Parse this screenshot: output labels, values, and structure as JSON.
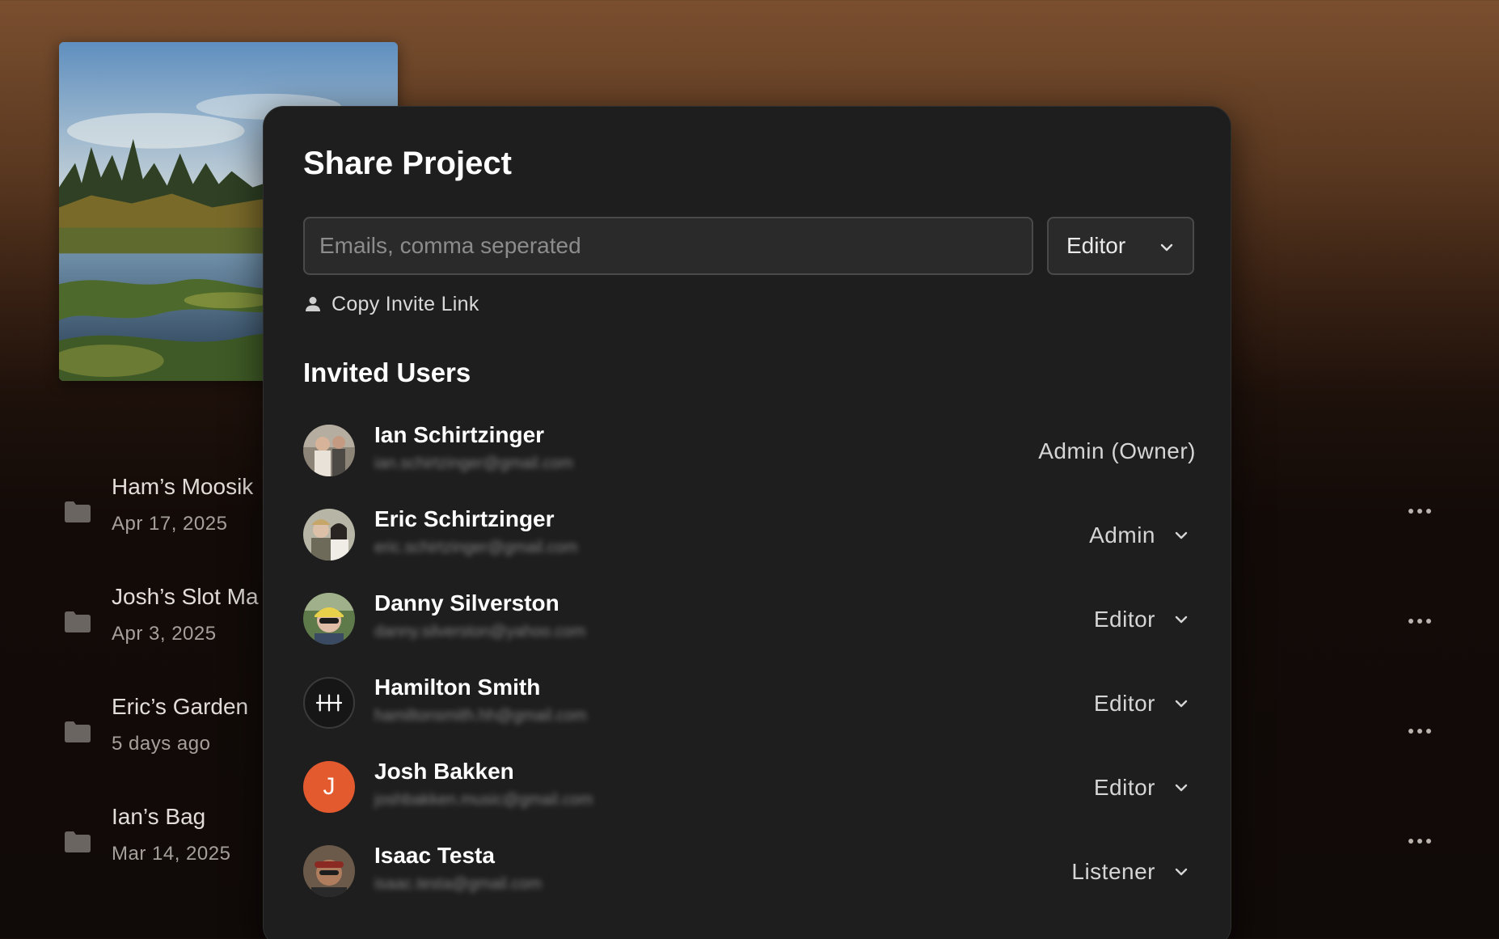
{
  "projects": [
    {
      "name": "Ham’s Moosik",
      "date": "Apr 17, 2025"
    },
    {
      "name": "Josh’s Slot Ma",
      "date": "Apr 3, 2025"
    },
    {
      "name": "Eric’s Garden",
      "date": "5 days ago"
    },
    {
      "name": "Ian’s Bag",
      "date": "Mar 14, 2025"
    }
  ],
  "modal": {
    "title": "Share Project",
    "email_placeholder": "Emails, comma seperated",
    "role_select": "Editor",
    "copy_link_label": "Copy Invite Link",
    "invited_title": "Invited Users"
  },
  "users": [
    {
      "name": "Ian Schirtzinger",
      "email": "ian.schirtzinger@gmail.com",
      "role": "Admin (Owner)",
      "avatar": "photo"
    },
    {
      "name": "Eric Schirtzinger",
      "email": "eric.schirtzinger@gmail.com",
      "role": "Admin",
      "avatar": "photo"
    },
    {
      "name": "Danny Silverston",
      "email": "danny.silverston@yahoo.com",
      "role": "Editor",
      "avatar": "photo"
    },
    {
      "name": "Hamilton Smith",
      "email": "hamiltonsmith.hh@gmail.com",
      "role": "Editor",
      "avatar": "logo"
    },
    {
      "name": "Josh Bakken",
      "email": "joshbakken.music@gmail.com",
      "role": "Editor",
      "avatar": "initial",
      "initial": "J"
    },
    {
      "name": "Isaac Testa",
      "email": "isaac.testa@gmail.com",
      "role": "Listener",
      "avatar": "photo"
    }
  ],
  "colors": {
    "modal_bg": "#1e1e1e",
    "initial_avatar": "#e45a2f"
  }
}
